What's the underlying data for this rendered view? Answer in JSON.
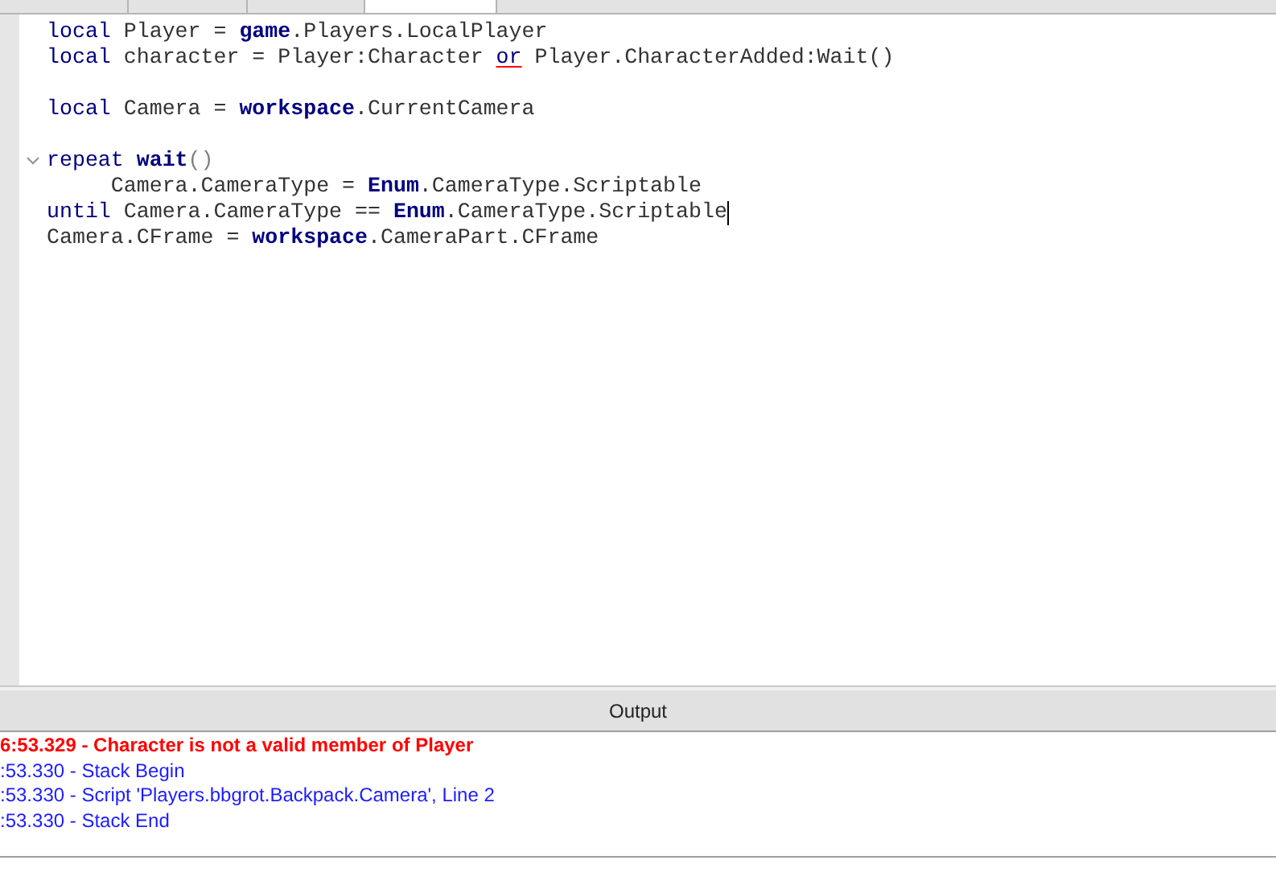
{
  "tabs": [
    {
      "selected": false
    },
    {
      "selected": false
    },
    {
      "selected": false
    },
    {
      "selected": true
    }
  ],
  "editor": {
    "lines": [
      {
        "kind": "code",
        "fold": false,
        "cursor": false,
        "tokens": [
          {
            "text": "local",
            "kind": "keyword",
            "flagged": false
          },
          {
            "text": " Player = ",
            "kind": "plain",
            "flagged": false
          },
          {
            "text": "game",
            "kind": "builtin",
            "flagged": false
          },
          {
            "text": ".Players.LocalPlayer",
            "kind": "plain",
            "flagged": false
          }
        ]
      },
      {
        "kind": "code",
        "fold": false,
        "cursor": false,
        "tokens": [
          {
            "text": "local",
            "kind": "keyword",
            "flagged": false
          },
          {
            "text": " character = Player:Character ",
            "kind": "plain",
            "flagged": false
          },
          {
            "text": "or",
            "kind": "keyword",
            "flagged": true
          },
          {
            "text": " Player.CharacterAdded:Wait()",
            "kind": "plain",
            "flagged": false
          }
        ]
      },
      {
        "kind": "blank"
      },
      {
        "kind": "code",
        "fold": false,
        "cursor": false,
        "tokens": [
          {
            "text": "local",
            "kind": "keyword",
            "flagged": false
          },
          {
            "text": " Camera = ",
            "kind": "plain",
            "flagged": false
          },
          {
            "text": "workspace",
            "kind": "builtin",
            "flagged": false
          },
          {
            "text": ".CurrentCamera",
            "kind": "plain",
            "flagged": false
          }
        ]
      },
      {
        "kind": "blank"
      },
      {
        "kind": "code",
        "fold": true,
        "cursor": false,
        "tokens": [
          {
            "text": "repeat ",
            "kind": "keyword",
            "flagged": false
          },
          {
            "text": "wait",
            "kind": "builtin",
            "flagged": false
          },
          {
            "text": "()",
            "kind": "paren",
            "flagged": false
          }
        ]
      },
      {
        "kind": "code",
        "fold": false,
        "cursor": false,
        "tokens": [
          {
            "text": "     Camera.CameraType = ",
            "kind": "plain",
            "flagged": false
          },
          {
            "text": "Enum",
            "kind": "builtin",
            "flagged": false
          },
          {
            "text": ".CameraType.Scriptable",
            "kind": "plain",
            "flagged": false
          }
        ]
      },
      {
        "kind": "code",
        "fold": false,
        "cursor": true,
        "tokens": [
          {
            "text": "until",
            "kind": "keyword",
            "flagged": false
          },
          {
            "text": " Camera.CameraType == ",
            "kind": "plain",
            "flagged": false
          },
          {
            "text": "Enum",
            "kind": "builtin",
            "flagged": false
          },
          {
            "text": ".CameraType.Scriptable",
            "kind": "plain",
            "flagged": false
          }
        ]
      },
      {
        "kind": "code",
        "fold": false,
        "cursor": false,
        "tokens": [
          {
            "text": "Camera.CFrame = ",
            "kind": "plain",
            "flagged": false
          },
          {
            "text": "workspace",
            "kind": "builtin",
            "flagged": false
          },
          {
            "text": ".CameraPart.CFrame",
            "kind": "plain",
            "flagged": false
          }
        ]
      }
    ]
  },
  "output": {
    "title": "Output",
    "messages": [
      {
        "text": "6:53.329 - Character is not a valid member of Player",
        "kind": "error"
      },
      {
        "text": ":53.330 - Stack Begin",
        "kind": "info"
      },
      {
        "text": ":53.330 - Script 'Players.bbgrot.Backpack.Camera', Line 2",
        "kind": "info"
      },
      {
        "text": ":53.330 - Stack End",
        "kind": "info"
      }
    ]
  }
}
